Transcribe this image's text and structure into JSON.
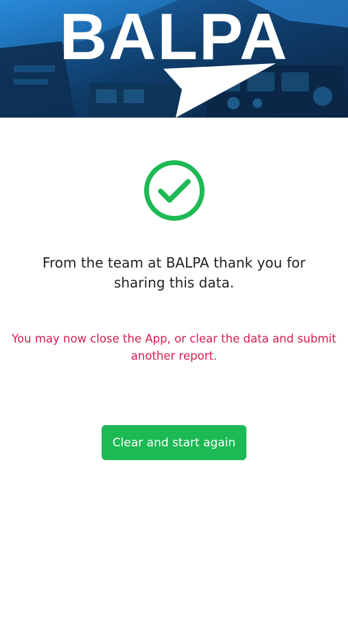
{
  "header": {
    "logo_text": "BALPA",
    "logo_icon": "paper-plane-logo",
    "background": "cockpit-image"
  },
  "status": {
    "icon": "check-circle-icon",
    "color": "#1db954"
  },
  "messages": {
    "thanks": "From the team at BALPA thank you for sharing this data.",
    "notice": "You may now close the App, or clear the data and submit another report.",
    "notice_color": "#d81b4f"
  },
  "actions": {
    "clear_label": "Clear and start again",
    "button_color": "#1db954"
  }
}
